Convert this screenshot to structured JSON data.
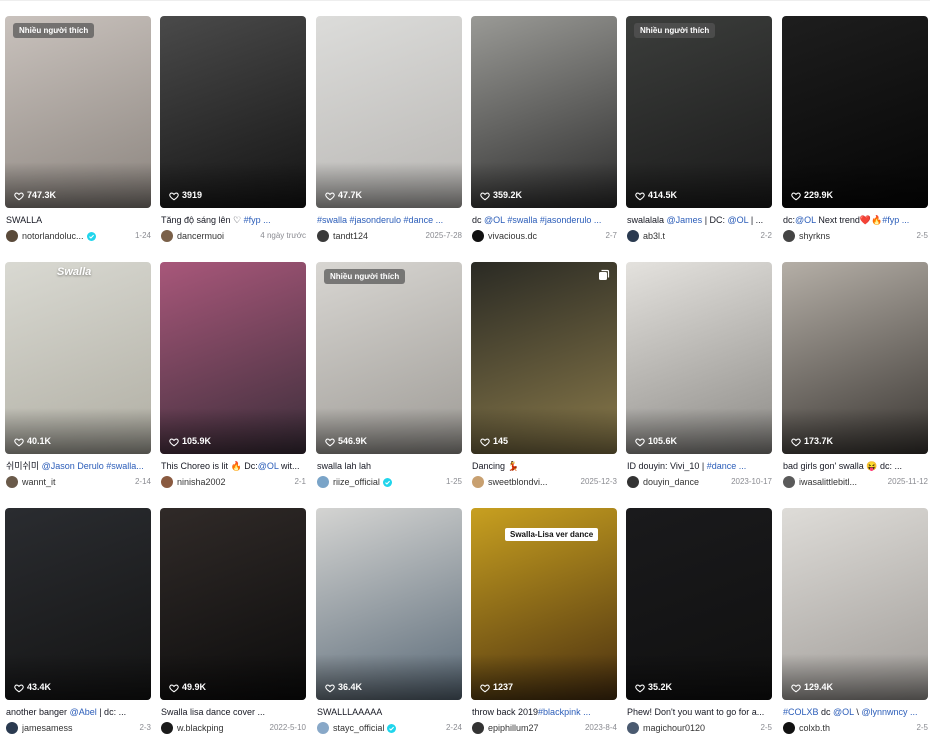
{
  "tags": {
    "popular": "Nhiều người thích"
  },
  "videos": [
    {
      "likes": "747.3K",
      "caption": [
        {
          "t": "SWALLA"
        }
      ],
      "user": "notorlandoluc...",
      "verified": true,
      "date": "1-24",
      "badge": true,
      "photo": false,
      "overlay": "",
      "colors": [
        "#c9c2bd",
        "#8c857f"
      ],
      "avatar": "#5a4a3a"
    },
    {
      "likes": "3919",
      "caption": [
        {
          "t": "Tăng độ sáng lên ♡ "
        },
        {
          "t": "#fyp ...",
          "hl": true
        }
      ],
      "user": "dancermuoi",
      "verified": false,
      "date": "4 ngày trước",
      "badge": false,
      "photo": false,
      "overlay": "",
      "colors": [
        "#4a4a4a",
        "#141414"
      ],
      "avatar": "#7a6048"
    },
    {
      "likes": "47.7K",
      "caption": [
        {
          "t": "#swalla #jasonderulo #dance ...",
          "hl": true
        }
      ],
      "user": "tandt124",
      "verified": false,
      "date": "2025-7-28",
      "badge": false,
      "photo": false,
      "overlay": "",
      "colors": [
        "#dcdcda",
        "#b8b6b3"
      ],
      "avatar": "#3a3a3a"
    },
    {
      "likes": "359.2K",
      "caption": [
        {
          "t": "dc "
        },
        {
          "t": "@OL #swalla #jasonderulo ...",
          "hl": true
        }
      ],
      "user": "vivacious.dc",
      "verified": false,
      "date": "2-7",
      "badge": false,
      "photo": false,
      "overlay": "",
      "colors": [
        "#9a9a96",
        "#2c2c2c"
      ],
      "avatar": "#111111"
    },
    {
      "likes": "414.5K",
      "caption": [
        {
          "t": "swalalala "
        },
        {
          "t": "@James",
          "hl": true
        },
        {
          "t": " | DC: "
        },
        {
          "t": "@OL",
          "hl": true
        },
        {
          "t": " | ..."
        }
      ],
      "user": "ab3l.t",
      "verified": false,
      "date": "2-2",
      "badge": true,
      "photo": false,
      "overlay": "",
      "colors": [
        "#3c3e3c",
        "#1a1a1a"
      ],
      "avatar": "#2a3a50"
    },
    {
      "likes": "229.9K",
      "caption": [
        {
          "t": "dc:"
        },
        {
          "t": "@OL",
          "hl": true
        },
        {
          "t": " Next trend❤️🔥"
        },
        {
          "t": "#fyp ...",
          "hl": true
        }
      ],
      "user": "shyrkns",
      "verified": false,
      "date": "2-5",
      "badge": false,
      "photo": false,
      "overlay": "",
      "colors": [
        "#1e1e1e",
        "#050505"
      ],
      "avatar": "#444444"
    },
    {
      "likes": "40.1K",
      "caption": [
        {
          "t": "쉬미쉬미 "
        },
        {
          "t": "@Jason Derulo #swalla...",
          "hl": true
        }
      ],
      "user": "wannt_it",
      "verified": false,
      "date": "2-14",
      "badge": false,
      "photo": false,
      "overlay": "Swalla",
      "colors": [
        "#d9d9d2",
        "#b0aea3"
      ],
      "avatar": "#6a5a4a"
    },
    {
      "likes": "105.9K",
      "caption": [
        {
          "t": "This Choreo is lit 🔥 Dc:"
        },
        {
          "t": "@OL",
          "hl": true
        },
        {
          "t": " wit..."
        }
      ],
      "user": "ninisha2002",
      "verified": false,
      "date": "2-1",
      "badge": false,
      "photo": false,
      "overlay": "",
      "colors": [
        "#a8577a",
        "#3c2e3a"
      ],
      "avatar": "#8a5a40"
    },
    {
      "likes": "546.9K",
      "caption": [
        {
          "t": "swalla lah lah"
        }
      ],
      "user": "riize_official",
      "verified": true,
      "date": "1-25",
      "badge": true,
      "photo": false,
      "overlay": "",
      "colors": [
        "#d8d6d2",
        "#9e9b96"
      ],
      "avatar": "#7aa4c8"
    },
    {
      "likes": "145",
      "caption": [
        {
          "t": "Dancing 💃"
        }
      ],
      "user": "sweetblondvi...",
      "verified": false,
      "date": "2025-12-3",
      "badge": false,
      "photo": true,
      "overlay": "",
      "colors": [
        "#2a2a24",
        "#8a7a4a"
      ],
      "avatar": "#c8a070"
    },
    {
      "likes": "105.6K",
      "caption": [
        {
          "t": "ID douyin: Vivi_10 | "
        },
        {
          "t": "#dance ...",
          "hl": true
        }
      ],
      "user": "douyin_dance",
      "verified": false,
      "date": "2023-10-17",
      "badge": false,
      "photo": false,
      "overlay": "",
      "colors": [
        "#e4e2de",
        "#8c8a86"
      ],
      "avatar": "#333333"
    },
    {
      "likes": "173.7K",
      "caption": [
        {
          "t": "bad girls gon' swalla 😝 dc: ..."
        }
      ],
      "user": "iwasalittlebitl...",
      "verified": false,
      "date": "2025-11-12",
      "badge": false,
      "photo": false,
      "overlay": "",
      "colors": [
        "#b5afa7",
        "#3a3632"
      ],
      "avatar": "#5a5a5a"
    },
    {
      "likes": "43.4K",
      "caption": [
        {
          "t": "another banger "
        },
        {
          "t": "@Abel",
          "hl": true
        },
        {
          "t": " | dc: ..."
        }
      ],
      "user": "jamesamess",
      "verified": false,
      "date": "2-3",
      "badge": false,
      "photo": false,
      "overlay": "",
      "colors": [
        "#2a2c30",
        "#141414"
      ],
      "avatar": "#2a3a50"
    },
    {
      "likes": "49.9K",
      "caption": [
        {
          "t": "Swalla lisa dance cover ..."
        }
      ],
      "user": "w.blackping",
      "verified": false,
      "date": "2022-5-10",
      "badge": false,
      "photo": false,
      "overlay": "",
      "colors": [
        "#302a28",
        "#0c0c0c"
      ],
      "avatar": "#1a1a1a"
    },
    {
      "likes": "36.4K",
      "caption": [
        {
          "t": "SWALLLAAAAA"
        }
      ],
      "user": "stayc_official",
      "verified": true,
      "date": "2-24",
      "badge": false,
      "photo": false,
      "overlay": "",
      "colors": [
        "#d4d4d2",
        "#5a6a78"
      ],
      "avatar": "#88a8c8"
    },
    {
      "likes": "1237",
      "caption": [
        {
          "t": "throw back 2019"
        },
        {
          "t": "#blackpink ...",
          "hl": true
        }
      ],
      "user": "epiphillum27",
      "verified": false,
      "date": "2023-8-4",
      "badge": false,
      "photo": false,
      "overlay": "Swalla-Lisa ver dance",
      "colors": [
        "#c8a020",
        "#4a3010"
      ],
      "avatar": "#333333"
    },
    {
      "likes": "35.2K",
      "caption": [
        {
          "t": "Phew! Don't you want to go for a..."
        }
      ],
      "user": "magichour0120",
      "verified": false,
      "date": "2-5",
      "badge": false,
      "photo": false,
      "overlay": "",
      "colors": [
        "#1a1a1c",
        "#101010"
      ],
      "avatar": "#4a5a70"
    },
    {
      "likes": "129.4K",
      "caption": [
        {
          "t": "#COLXB",
          "hl": true
        },
        {
          "t": " dc "
        },
        {
          "t": "@OL",
          "hl": true
        },
        {
          "t": " \\ "
        },
        {
          "t": "@lynnwncy ...",
          "hl": true
        }
      ],
      "user": "colxb.th",
      "verified": false,
      "date": "2-5",
      "badge": false,
      "photo": false,
      "overlay": "",
      "colors": [
        "#dedcd8",
        "#a09c98"
      ],
      "avatar": "#111111"
    }
  ]
}
